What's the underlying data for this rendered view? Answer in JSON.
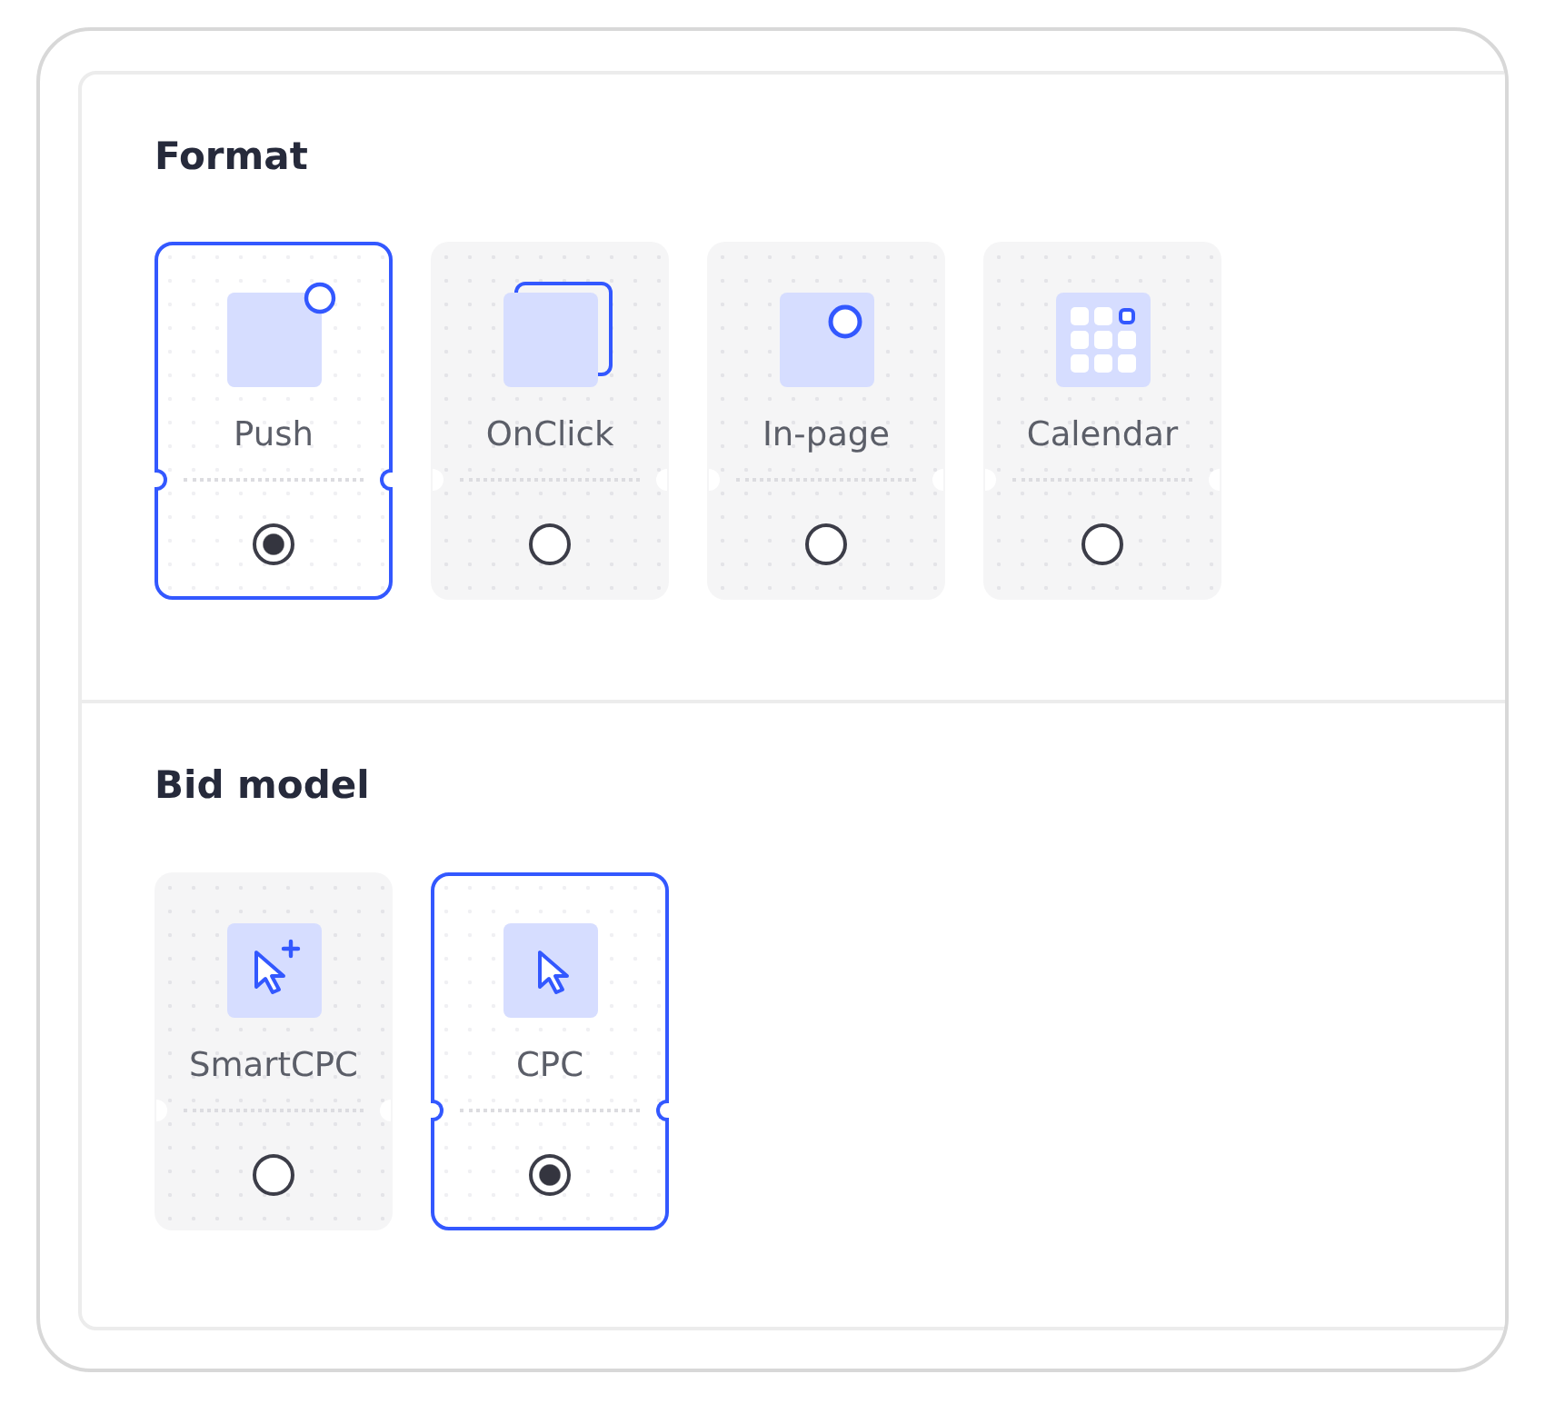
{
  "sections": [
    {
      "title": "Format",
      "options": [
        {
          "label": "Push",
          "kind": "push",
          "selected": true
        },
        {
          "label": "OnClick",
          "kind": "onclick",
          "selected": false
        },
        {
          "label": "In-page",
          "kind": "inpage",
          "selected": false
        },
        {
          "label": "Calendar",
          "kind": "calendar",
          "selected": false
        }
      ]
    },
    {
      "title": "Bid model",
      "options": [
        {
          "label": "SmartCPC",
          "kind": "smartcursor",
          "selected": false
        },
        {
          "label": "CPC",
          "kind": "cursor",
          "selected": true
        }
      ]
    }
  ]
}
